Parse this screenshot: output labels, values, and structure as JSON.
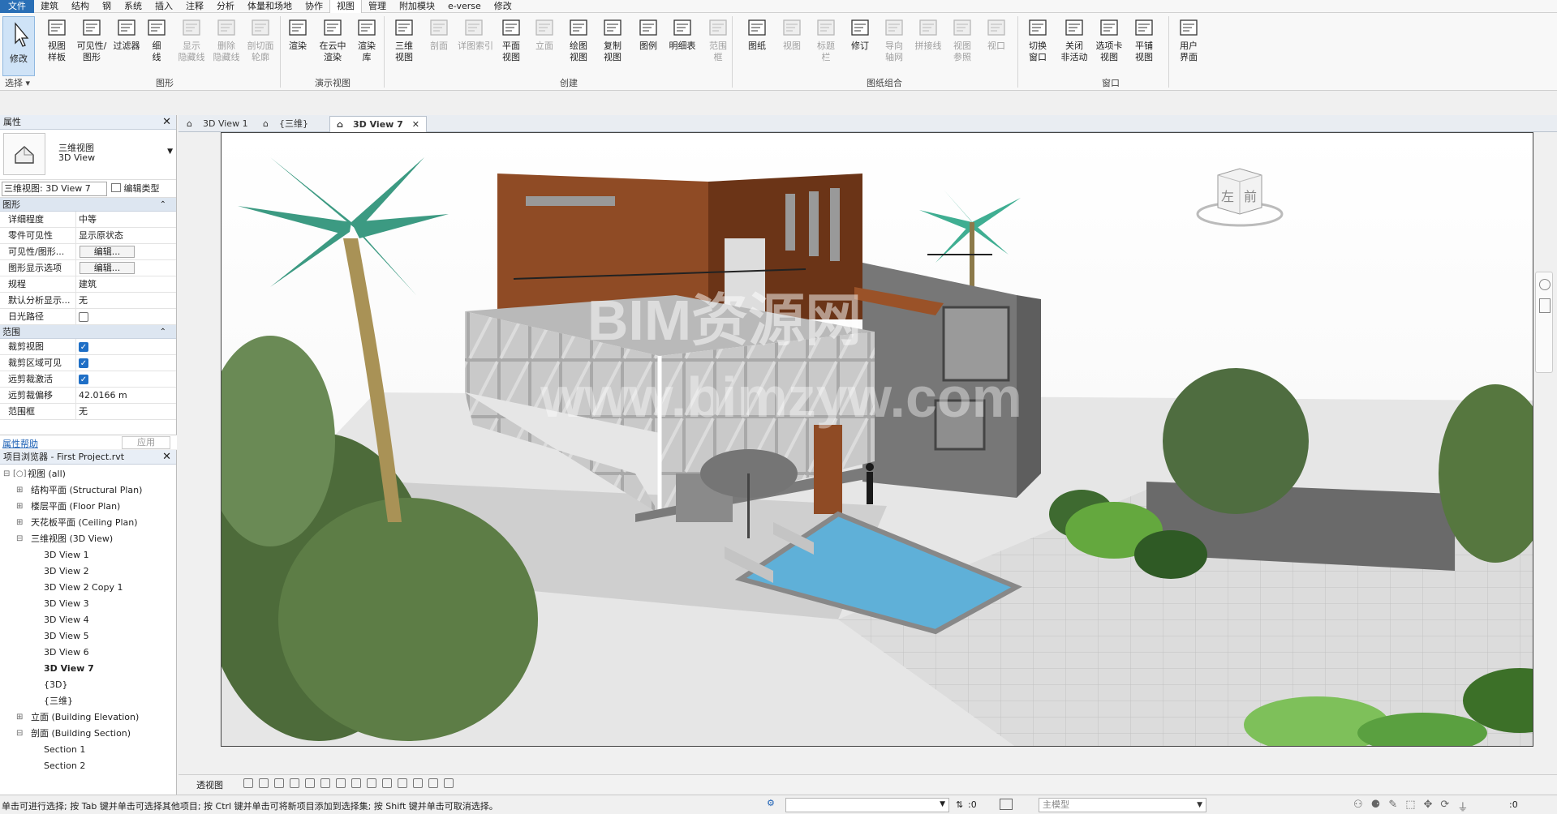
{
  "menu": [
    "文件",
    "建筑",
    "结构",
    "钢",
    "系统",
    "插入",
    "注释",
    "分析",
    "体量和场地",
    "协作",
    "视图",
    "管理",
    "附加模块",
    "e-verse",
    "修改"
  ],
  "ribbon": {
    "modify": "修改",
    "select_label": "选择",
    "buttons": [
      {
        "l1": "视图",
        "l2": "样板",
        "dis": false
      },
      {
        "l1": "可见性/",
        "l2": "图形",
        "dis": false
      },
      {
        "l1": "过滤器",
        "l2": "",
        "dis": false
      },
      {
        "l1": "细",
        "l2": "线",
        "dis": false
      },
      {
        "l1": "显示",
        "l2": "隐藏线",
        "dis": true
      },
      {
        "l1": "删除",
        "l2": "隐藏线",
        "dis": true
      },
      {
        "l1": "剖切面",
        "l2": "轮廓",
        "dis": true
      },
      {
        "l1": "渲染",
        "l2": "",
        "dis": false
      },
      {
        "l1": "在云中",
        "l2": "渲染",
        "dis": false
      },
      {
        "l1": "渲染",
        "l2": "库",
        "dis": false
      },
      {
        "l1": "三维",
        "l2": "视图",
        "dis": false
      },
      {
        "l1": "剖面",
        "l2": "",
        "dis": true
      },
      {
        "l1": "详图索引",
        "l2": "",
        "dis": true
      },
      {
        "l1": "平面",
        "l2": "视图",
        "dis": false
      },
      {
        "l1": "立面",
        "l2": "",
        "dis": true
      },
      {
        "l1": "绘图",
        "l2": "视图",
        "dis": false
      },
      {
        "l1": "复制",
        "l2": "视图",
        "dis": false
      },
      {
        "l1": "图例",
        "l2": "",
        "dis": false
      },
      {
        "l1": "明细表",
        "l2": "",
        "dis": false
      },
      {
        "l1": "范围",
        "l2": "框",
        "dis": true
      },
      {
        "l1": "图纸",
        "l2": "",
        "dis": false
      },
      {
        "l1": "视图",
        "l2": "",
        "dis": true
      },
      {
        "l1": "标题",
        "l2": "栏",
        "dis": true
      },
      {
        "l1": "修订",
        "l2": "",
        "dis": false
      },
      {
        "l1": "导向",
        "l2": "轴网",
        "dis": true
      },
      {
        "l1": "拼接线",
        "l2": "",
        "dis": true
      },
      {
        "l1": "视图",
        "l2": "参照",
        "dis": true
      },
      {
        "l1": "视口",
        "l2": "",
        "dis": true
      },
      {
        "l1": "切换",
        "l2": "窗口",
        "dis": false
      },
      {
        "l1": "关闭",
        "l2": "非活动",
        "dis": false
      },
      {
        "l1": "选项卡",
        "l2": "视图",
        "dis": false
      },
      {
        "l1": "平铺",
        "l2": "视图",
        "dis": false
      },
      {
        "l1": "用户",
        "l2": "界面",
        "dis": false
      }
    ],
    "panels": [
      "图形",
      "演示视图",
      "创建",
      "图纸组合",
      "窗口"
    ]
  },
  "properties": {
    "title": "属性",
    "type_l1": "三维视图",
    "type_l2": "3D View",
    "selector": "三维视图: 3D View 7",
    "edit_type": "编辑类型",
    "section_graphics": "图形",
    "section_extents": "范围",
    "rows": [
      {
        "k": "详细程度",
        "v": "中等"
      },
      {
        "k": "零件可见性",
        "v": "显示原状态"
      },
      {
        "k": "可见性/图形...",
        "v": "编辑..."
      },
      {
        "k": "图形显示选项",
        "v": "编辑..."
      },
      {
        "k": "规程",
        "v": "建筑"
      },
      {
        "k": "默认分析显示...",
        "v": "无"
      },
      {
        "k": "日光路径",
        "v": ""
      }
    ],
    "rows2": [
      {
        "k": "裁剪视图",
        "v": ""
      },
      {
        "k": "裁剪区域可见",
        "v": ""
      },
      {
        "k": "远剪裁激活",
        "v": ""
      },
      {
        "k": "远剪裁偏移",
        "v": "42.0166 m"
      },
      {
        "k": "范围框",
        "v": "无"
      }
    ],
    "help": "属性帮助",
    "apply": "应用"
  },
  "browser": {
    "title": "项目浏览器 - First Project.rvt",
    "items": [
      {
        "t": "视图 (all)",
        "lvl": 0,
        "g": "⊟"
      },
      {
        "t": "结构平面 (Structural Plan)",
        "lvl": 1,
        "g": "⊞"
      },
      {
        "t": "楼层平面 (Floor Plan)",
        "lvl": 1,
        "g": "⊞"
      },
      {
        "t": "天花板平面 (Ceiling Plan)",
        "lvl": 1,
        "g": "⊞"
      },
      {
        "t": "三维视图 (3D View)",
        "lvl": 1,
        "g": "⊟"
      },
      {
        "t": "3D View 1",
        "lvl": 2,
        "g": ""
      },
      {
        "t": "3D View 2",
        "lvl": 2,
        "g": ""
      },
      {
        "t": "3D View 2 Copy 1",
        "lvl": 2,
        "g": ""
      },
      {
        "t": "3D View 3",
        "lvl": 2,
        "g": ""
      },
      {
        "t": "3D View 4",
        "lvl": 2,
        "g": ""
      },
      {
        "t": "3D View 5",
        "lvl": 2,
        "g": ""
      },
      {
        "t": "3D View 6",
        "lvl": 2,
        "g": ""
      },
      {
        "t": "3D View 7",
        "lvl": 2,
        "g": "",
        "bold": true
      },
      {
        "t": "{3D}",
        "lvl": 2,
        "g": ""
      },
      {
        "t": "{三维}",
        "lvl": 2,
        "g": ""
      },
      {
        "t": "立面 (Building Elevation)",
        "lvl": 1,
        "g": "⊞"
      },
      {
        "t": "剖面 (Building Section)",
        "lvl": 1,
        "g": "⊟"
      },
      {
        "t": "Section 1",
        "lvl": 2,
        "g": ""
      },
      {
        "t": "Section 2",
        "lvl": 2,
        "g": ""
      }
    ]
  },
  "tabs": [
    {
      "label": "3D View 1",
      "active": false
    },
    {
      "label": "{三维}",
      "active": false
    },
    {
      "label": "3D View 7",
      "active": true
    }
  ],
  "viewcube": {
    "left": "左",
    "front": "前"
  },
  "watermark": {
    "l1": "BIM资源网",
    "l2": "www.bimzyw.com"
  },
  "view_control": {
    "label": "透视图"
  },
  "status": {
    "message": "单击可进行选择; 按 Tab 键并单击可选择其他项目; 按 Ctrl 键并单击可将新项目添加到选择集; 按 Shift 键并单击可取消选择。",
    "zero1": ":0",
    "model": "主模型",
    "filter": ":0"
  }
}
